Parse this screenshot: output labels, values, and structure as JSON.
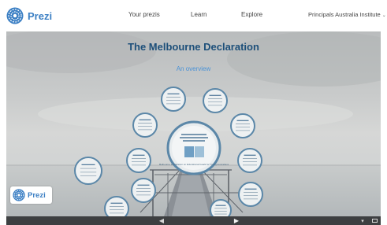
{
  "header": {
    "logo_text": "Prezi",
    "nav": [
      "Your prezis",
      "Learn",
      "Explore"
    ],
    "account": "Principals Australia Institute",
    "account_caret": "⌄"
  },
  "presentation": {
    "title": "The Melbourne Declaration",
    "subtitle": "An overview",
    "center_frame_caption": "Melbourne Declaration on Educational Goals for Young Australians",
    "frame_count": 11
  },
  "badge": {
    "logo_text": "Prezi"
  },
  "controls": {
    "prev_icon": "arrow-left-icon",
    "next_icon": "arrow-right-icon",
    "more_icon": "more-icon",
    "fullscreen_icon": "fullscreen-icon",
    "prev_glyph": "◀",
    "next_glyph": "▶",
    "more_glyph": "▾"
  },
  "colors": {
    "brand": "#3b7fc4",
    "title": "#1d4f7a",
    "subtitle": "#4a92d6",
    "frame_ring": "#5b87a8",
    "control_bar": "#3d3f41"
  }
}
